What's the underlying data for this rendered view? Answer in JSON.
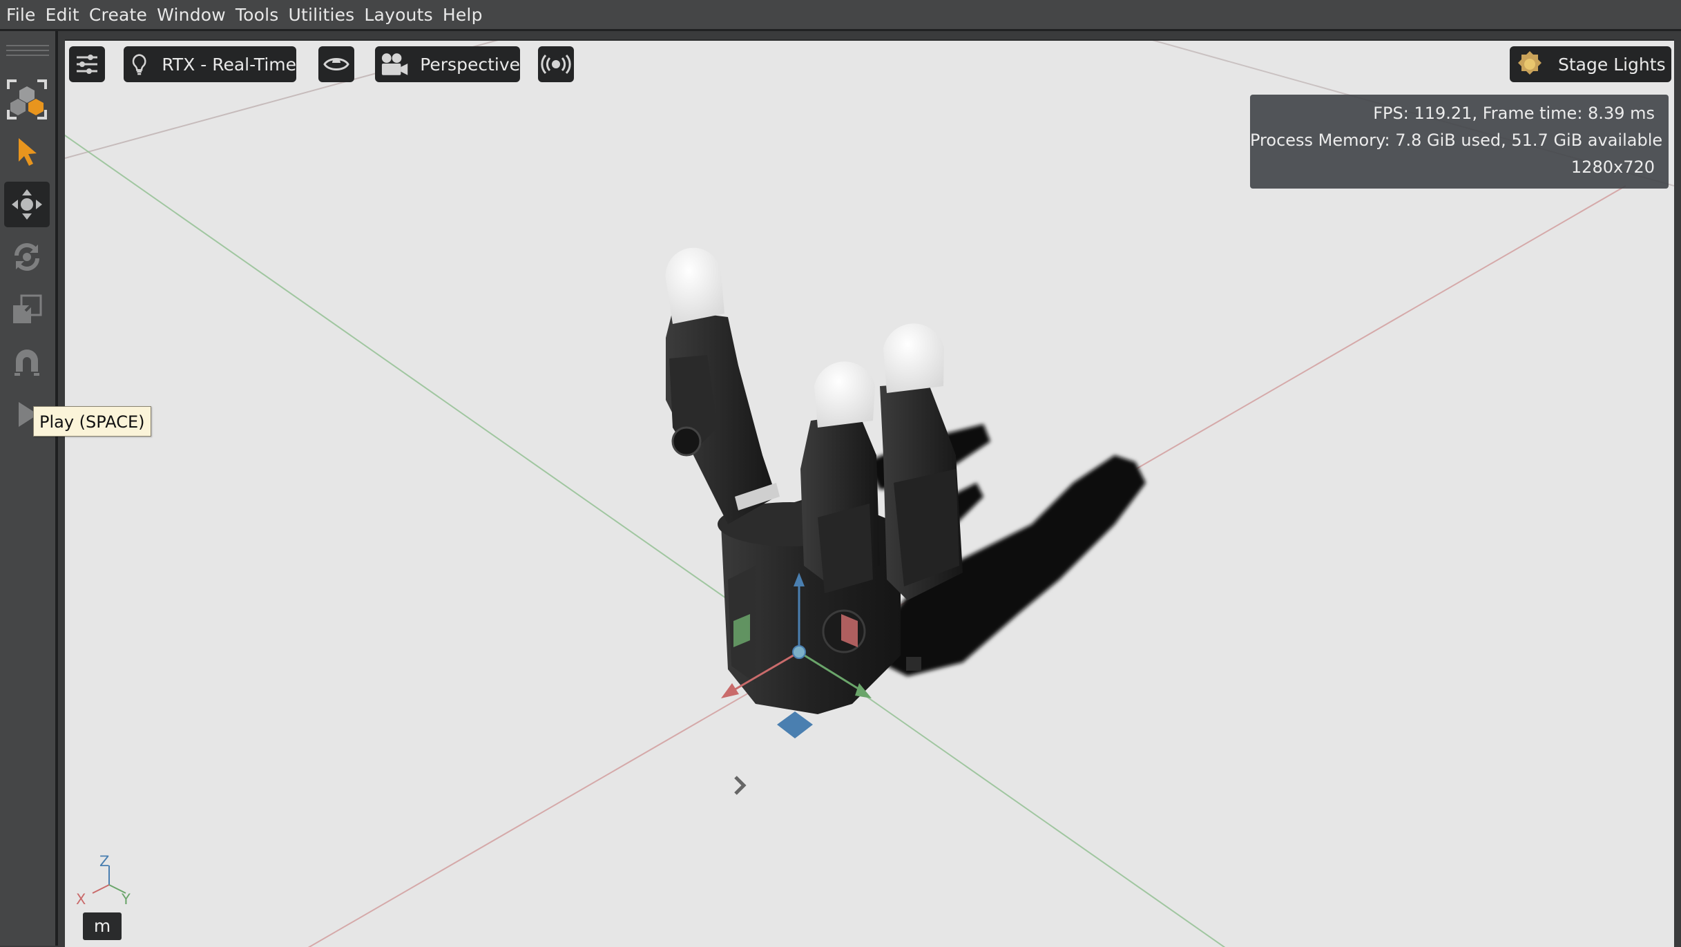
{
  "menu": [
    "File",
    "Edit",
    "Create",
    "Window",
    "Tools",
    "Utilities",
    "Layouts",
    "Help"
  ],
  "left_toolbar": {
    "tools": [
      {
        "name": "frame-selection",
        "icon": "frame-cube-icon",
        "active": false
      },
      {
        "name": "select",
        "icon": "arrow-cursor-icon",
        "active": false
      },
      {
        "name": "move",
        "icon": "move-arrows-icon",
        "active": true
      },
      {
        "name": "rotate",
        "icon": "rotate-icon",
        "active": false
      },
      {
        "name": "scale",
        "icon": "scale-icon",
        "active": false
      },
      {
        "name": "snap",
        "icon": "magnet-icon",
        "active": false
      },
      {
        "name": "play",
        "icon": "play-icon",
        "active": false
      }
    ],
    "tooltip": "Play (SPACE)"
  },
  "viewport": {
    "toolbar": {
      "settings_icon": "sliders-icon",
      "renderer_icon": "lightbulb-icon",
      "renderer_label": "RTX - Real-Time",
      "visibility_icon": "eye-icon",
      "camera_icon": "camera-icon",
      "camera_label": "Perspective",
      "broadcast_icon": "broadcast-icon",
      "lights_icon": "sun-icon",
      "lights_label": "Stage Lights"
    },
    "stats": {
      "fps": "FPS: 119.21, Frame time: 8.39 ms",
      "memory": "Process Memory: 7.8 GiB used, 51.7 GiB available",
      "resolution": "1280x720"
    },
    "axis_gizmo": {
      "z": "Z",
      "x": "X",
      "y": "Y"
    },
    "unit": "m",
    "colors": {
      "background": "#e6e6e6",
      "x_axis": "#c96b6b",
      "y_axis": "#6aa56a",
      "z_axis": "#4a7fb0",
      "accent": "#e8951e"
    }
  }
}
